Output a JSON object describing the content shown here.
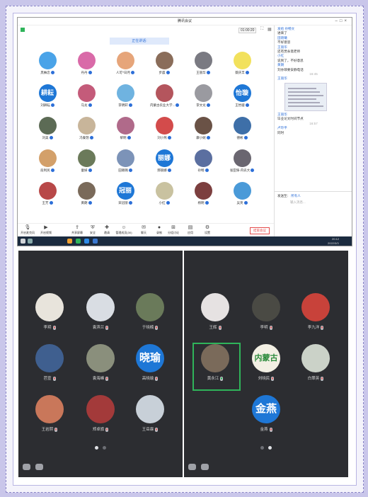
{
  "meeting": {
    "window_title": "腾讯会议",
    "timer": "01:00:20",
    "speaking_label": "正在讲话:",
    "end_button": "结束会议"
  },
  "participants": [
    {
      "name": "黑柚恋",
      "color": "#4aa3e8",
      "text": ""
    },
    {
      "name": "丹丹",
      "color": "#d96aa8",
      "text": ""
    },
    {
      "name": "人可^日月",
      "color": "#e6a57a",
      "text": ""
    },
    {
      "name": "步晨",
      "color": "#8a6d5a",
      "text": ""
    },
    {
      "name": "王丽华",
      "color": "#7a7a82",
      "text": ""
    },
    {
      "name": "薇庆丰",
      "color": "#f2e15c",
      "text": ""
    },
    {
      "name": "刘耕耘",
      "color": "#1e77d6",
      "text": "耕耘"
    },
    {
      "name": "马龙",
      "color": "#c45b7a",
      "text": ""
    },
    {
      "name": "李明轩",
      "color": "#6fb3e0",
      "text": ""
    },
    {
      "name": "内蒙古农业大学...",
      "color": "#b4555d",
      "text": ""
    },
    {
      "name": "李文龙",
      "color": "#9a9aa0",
      "text": ""
    },
    {
      "name": "王怡璇",
      "color": "#1e77d6",
      "text": "怡璇"
    },
    {
      "name": "刘美",
      "color": "#5c6b55",
      "text": ""
    },
    {
      "name": "冯秦怒",
      "color": "#c8b59a",
      "text": ""
    },
    {
      "name": "黎明",
      "color": "#b06a8a",
      "text": ""
    },
    {
      "name": "刘小燕",
      "color": "#d34b4b",
      "text": ""
    },
    {
      "name": "康小妮",
      "color": "#6a5246",
      "text": ""
    },
    {
      "name": "德彬",
      "color": "#3e6fa8",
      "text": ""
    },
    {
      "name": "段利民",
      "color": "#d3a06a",
      "text": ""
    },
    {
      "name": "童妍",
      "color": "#6b7a5a",
      "text": ""
    },
    {
      "name": "田璐璐",
      "color": "#7c93b8",
      "text": ""
    },
    {
      "name": "郝丽娜",
      "color": "#1e77d6",
      "text": "丽娜"
    },
    {
      "name": "孙畅",
      "color": "#5b6fa0",
      "text": ""
    },
    {
      "name": "张亚辉-内农大",
      "color": "#6a6670",
      "text": ""
    },
    {
      "name": "王芳",
      "color": "#b84848",
      "text": ""
    },
    {
      "name": "黄朗",
      "color": "#7a6a5a",
      "text": ""
    },
    {
      "name": "宋冠丽",
      "color": "#1e77d6",
      "text": "冠丽"
    },
    {
      "name": "小红",
      "color": "#c9c2a0",
      "text": ""
    },
    {
      "name": "杨明",
      "color": "#7c3f3f",
      "text": ""
    },
    {
      "name": "吴英",
      "color": "#4a9ad8",
      "text": ""
    }
  ],
  "toolbar": [
    {
      "icon": "mic-icon",
      "label": "开启麦克风"
    },
    {
      "icon": "video-icon",
      "label": "开启视频"
    },
    {
      "icon": "share-icon",
      "label": "共享屏幕"
    },
    {
      "icon": "shield-icon",
      "label": "安全"
    },
    {
      "icon": "invite-icon",
      "label": "邀请"
    },
    {
      "icon": "members-icon",
      "label": "管理成员(30)"
    },
    {
      "icon": "chat-icon",
      "label": "聊天"
    },
    {
      "icon": "record-icon",
      "label": "录制"
    },
    {
      "icon": "rooms-icon",
      "label": "分组讨论"
    },
    {
      "icon": "apps-icon",
      "label": "应用"
    },
    {
      "icon": "settings-icon",
      "label": "设置"
    }
  ],
  "taskbar": {
    "time": "20:12",
    "date": "2022/3/3"
  },
  "chat": {
    "messages": [
      {
        "kind": "from",
        "text": "发给 孙畅文"
      },
      {
        "kind": "body",
        "text": "进来了"
      },
      {
        "kind": "from",
        "text": "田晓曦"
      },
      {
        "kind": "body",
        "text": "不好意思"
      },
      {
        "kind": "from",
        "text": "王丽华"
      },
      {
        "kind": "body",
        "text": "还有贾永斋老师"
      },
      {
        "kind": "from",
        "text": "小红"
      },
      {
        "kind": "body",
        "text": "说到了，不好意思"
      },
      {
        "kind": "from",
        "text": "黄朗"
      },
      {
        "kind": "body",
        "text": "刘亦菲要安静电话"
      },
      {
        "kind": "time",
        "text": "16:45"
      },
      {
        "kind": "from",
        "text": "王丽华"
      },
      {
        "kind": "image",
        "text": ""
      },
      {
        "kind": "from",
        "text": "王丽华"
      },
      {
        "kind": "body",
        "text": "毕业论文时间节点"
      },
      {
        "kind": "time",
        "text": "16:57"
      },
      {
        "kind": "from",
        "text": "卢玲平"
      },
      {
        "kind": "body",
        "text": "同时"
      }
    ],
    "send_to_label": "发送至：",
    "send_to_value": "所有人",
    "placeholder": "输入消息..."
  },
  "phone_left": {
    "people": [
      {
        "name": "李玥",
        "color": "#e8e4dc",
        "text": ""
      },
      {
        "name": "袁滨兰",
        "color": "#d9dde3",
        "text": ""
      },
      {
        "name": "于晓楠",
        "color": "#6a7a5a",
        "text": ""
      },
      {
        "name": "芭宣",
        "color": "#3f5f8f",
        "text": ""
      },
      {
        "name": "袁海峰",
        "color": "#8a8f7c",
        "text": ""
      },
      {
        "name": "高晓瑜",
        "color": "#1e77d6",
        "text": "晓瑜"
      },
      {
        "name": "王岩阴",
        "color": "#c9775a",
        "text": ""
      },
      {
        "name": "郑卓旗",
        "color": "#a33a3a",
        "text": ""
      },
      {
        "name": "王岳霖",
        "color": "#c8d0d8",
        "text": ""
      }
    ]
  },
  "phone_right": {
    "people": [
      {
        "name": "王辉",
        "color": "#e6e2e2",
        "text": ""
      },
      {
        "name": "李明",
        "color": "#4a4a44",
        "text": ""
      },
      {
        "name": "李九洋",
        "color": "#c8423a",
        "text": ""
      },
      {
        "name": "黄永江",
        "color": "#7a6a5a",
        "text": ""
      },
      {
        "name": "刘晓民",
        "color": "#f3f0e4",
        "text": "内蒙古"
      },
      {
        "name": "白翠英",
        "color": "#cbd2c8",
        "text": ""
      },
      {
        "name": "金燕",
        "color": "#1e77d6",
        "text": "金燕"
      }
    ]
  }
}
